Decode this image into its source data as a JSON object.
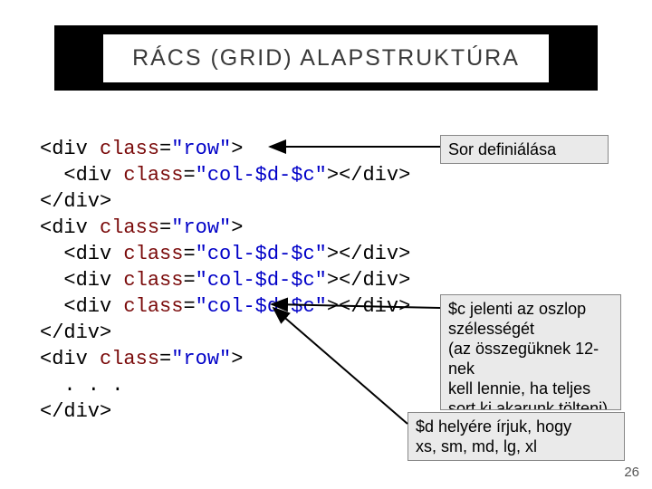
{
  "title": "RÁCS (GRID) ALAPSTRUKTÚRA",
  "code": {
    "rows": [
      {
        "indent": 0,
        "open": true,
        "cls": "row"
      },
      {
        "indent": 1,
        "open": false,
        "cls": "col-$d-$c"
      },
      {
        "indent": 0,
        "close": true
      },
      {
        "indent": 0,
        "open": true,
        "cls": "row"
      },
      {
        "indent": 1,
        "open": false,
        "cls": "col-$d-$c"
      },
      {
        "indent": 1,
        "open": false,
        "cls": "col-$d-$c"
      },
      {
        "indent": 1,
        "open": false,
        "cls": "col-$d-$c"
      },
      {
        "indent": 0,
        "close": true
      },
      {
        "indent": 0,
        "open": true,
        "cls": "row"
      },
      {
        "indent": 1,
        "text": ". . ."
      },
      {
        "indent": 0,
        "close": true
      }
    ]
  },
  "callouts": {
    "row_def": "Sor definiálása",
    "col_width": "$c jelenti az oszlop szélességét\n(az összegüknek 12-nek\nkell lennie, ha teljes\nsort ki akarunk tölteni)",
    "device": "$d helyére írjuk, hogy\nxs, sm, md, lg, xl"
  },
  "page_number": "26"
}
